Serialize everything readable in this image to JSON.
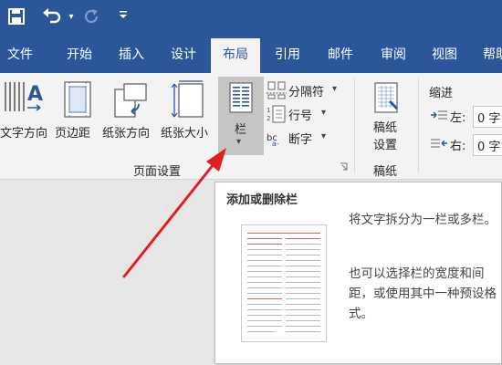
{
  "quick_access": {
    "save_icon": "save-icon",
    "undo_icon": "undo-icon",
    "redo_icon": "redo-icon",
    "customize_icon": "customize-qat-icon"
  },
  "tabs": [
    {
      "label": "文件"
    },
    {
      "label": "开始"
    },
    {
      "label": "插入"
    },
    {
      "label": "设计"
    },
    {
      "label": "布局",
      "active": true
    },
    {
      "label": "引用"
    },
    {
      "label": "邮件"
    },
    {
      "label": "审阅"
    },
    {
      "label": "视图"
    },
    {
      "label": "帮助"
    }
  ],
  "ribbon": {
    "page_setup": {
      "group_label": "页面设置",
      "text_direction": "文字方向",
      "margins": "页边距",
      "orientation": "纸张方向",
      "size": "纸张大小",
      "columns": "栏",
      "breaks": "分隔符",
      "line_numbers": "行号",
      "hyphenation": "断字"
    },
    "manuscript": {
      "group_label": "稿纸",
      "button_line1": "稿纸",
      "button_line2": "设置"
    },
    "indent": {
      "title": "缩进",
      "left_label": "左:",
      "left_value": "0 字",
      "right_label": "右:",
      "right_value": "0 字"
    }
  },
  "tooltip": {
    "title": "添加或删除栏",
    "paragraph1": "将文字拆分为一栏或多栏。",
    "paragraph2": "也可以选择栏的宽度和间距，或使用其中一种预设格式。"
  },
  "colors": {
    "accent": "#2b579a",
    "ribbon_bg": "#f3f3f3",
    "highlight": "#c5c5c5",
    "arrow": "#e02020"
  }
}
